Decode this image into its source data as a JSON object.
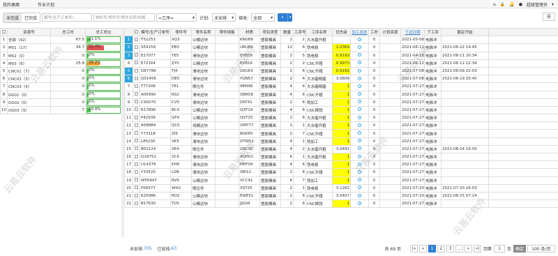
{
  "topbar": {
    "home": "我的桌面",
    "plan": "作业计划",
    "user": "超级管理员"
  },
  "toolbar": {
    "unfinished": "未完成",
    "finished": "已完成",
    "search_order_placeholder": "模号/生产订单号/...",
    "search_part_placeholder": "物料号/零件号/零件名称/规格",
    "process_select": "=工序=",
    "plan_label": "计划:",
    "plan_value": "未安排",
    "accept_label": "接收:",
    "accept_value": "全部"
  },
  "left_table": {
    "headers": [
      "资源号",
      "总工时",
      "总工时比"
    ],
    "rows": [
      {
        "idx": "1",
        "name": "全部（42）",
        "hours": "67.5",
        "pct": "11.1%",
        "ratio": 0.111,
        "color": "#4cc04c"
      },
      {
        "idx": "2",
        "name": "M01（17）",
        "hours": "34.7",
        "pct": "51.4%",
        "ratio": 0.514,
        "color": "#e05050"
      },
      {
        "idx": "3",
        "name": "M02（0）",
        "hours": "0",
        "pct": "0%",
        "ratio": 0,
        "color": "#4cc04c"
      },
      {
        "idx": "4",
        "name": "M03（6）",
        "hours": "25.8",
        "pct": "38.2%",
        "ratio": 0.382,
        "color": "#f0a030"
      },
      {
        "idx": "5",
        "name": "CNC01（7）",
        "hours": "0",
        "pct": "0%",
        "ratio": 0,
        "color": "#4cc04c"
      },
      {
        "idx": "6",
        "name": "CNC02（3）",
        "hours": "0",
        "pct": "0%",
        "ratio": 0,
        "color": "#4cc04c"
      },
      {
        "idx": "7",
        "name": "CNC03（4）",
        "hours": "0",
        "pct": "0%",
        "ratio": 0,
        "color": "#4cc04c"
      },
      {
        "idx": "8",
        "name": "DG01（0）",
        "hours": "0",
        "pct": "0%",
        "ratio": 0,
        "color": "#4cc04c"
      },
      {
        "idx": "9",
        "name": "DG02（0）",
        "hours": "0",
        "pct": "0%",
        "ratio": 0,
        "color": "#4cc04c"
      },
      {
        "idx": "10",
        "name": "DG03（5）",
        "hours": "7",
        "pct": "10.4%",
        "ratio": 0.104,
        "color": "#4cc04c"
      }
    ]
  },
  "main_table": {
    "headers": [
      "模号/生产订单号",
      "零件号",
      "零件名称",
      "零件规格",
      "材质",
      "项目类型",
      "数量",
      "工序号",
      "工序名称",
      "优先级",
      "加工状态",
      "工时",
      "计划资源",
      "下达日期",
      "下工序",
      "额定开始"
    ],
    "rows": [
      {
        "i": "1",
        "hl": true,
        "order": "T52253",
        "part": "XQ3",
        "name": "公模边块",
        "spec": "",
        "mat": "KNU89",
        "type": "塑胶模具",
        "qty": "2",
        "proc": "1",
        "pname": "大水磨开粗",
        "pri": "",
        "y": false,
        "hrs": "0",
        "res": "",
        "date": "2021-05-08",
        "next": "电脉冲",
        "start": ""
      },
      {
        "i": "2",
        "hl": true,
        "order": "S54159",
        "part": "EB3",
        "name": "公模边块",
        "spec": "",
        "mat": "URU89",
        "type": "塑胶模具",
        "qty": "12",
        "proc": "6",
        "pname": "铣电极",
        "pri": "1.0369",
        "y": true,
        "hrs": "0",
        "res": "",
        "date": "2021-06-12",
        "next": "电脉冲",
        "start": "2021-06-22 14:45"
      },
      {
        "i": "3",
        "hl": true,
        "order": "E17077",
        "part": "YE5",
        "name": "滑块边块",
        "spec": "",
        "mat": "EVB56",
        "type": "塑胶模具",
        "qty": "2",
        "proc": "5",
        "pname": "铣电极",
        "pri": "0.9193",
        "y": true,
        "hrs": "0",
        "res": "",
        "date": "2021-04-28",
        "next": "电脉冲",
        "start": "2021-08-11 20:34"
      },
      {
        "i": "4",
        "hl": false,
        "order": "E72164",
        "part": "ZY0",
        "name": "公模边块",
        "spec": "",
        "mat": "EVB16",
        "type": "塑胶模具",
        "qty": "2",
        "proc": "2",
        "pname": "CNC开粗",
        "pri": "0.9973",
        "y": true,
        "hrs": "0",
        "res": "",
        "date": "2021-06-12",
        "next": "电脉冲",
        "start": "2021-06-12 12:34"
      },
      {
        "i": "5",
        "hl": true,
        "order": "D87786",
        "part": "TJ4",
        "name": "滑块边块",
        "spec": "",
        "mat": "GKU63",
        "type": "塑胶模具",
        "qty": "2",
        "proc": "6",
        "pname": "CNC开粗",
        "pri": "0.9192",
        "y": true,
        "hrs": "0",
        "res": "",
        "date": "2021-07-08",
        "next": "电脉冲",
        "start": "2021-08-09 22:03"
      },
      {
        "i": "6",
        "hl": true,
        "order": "Q01456",
        "part": "DE5",
        "name": "滑块边块",
        "spec": "",
        "mat": "YQN57",
        "type": "塑胶模具",
        "qty": "2",
        "proc": "4",
        "pname": "大水磨精磨",
        "pri": "3.0609",
        "y": false,
        "hrs": "0",
        "res": "",
        "date": "2021-07-08",
        "next": "电脉冲",
        "start": "2021-08-19 20:40"
      },
      {
        "i": "7",
        "hl": false,
        "order": "T77208",
        "part": "YE1",
        "name": "限位件",
        "spec": "",
        "mat": "IMM48",
        "type": "塑胶模具",
        "qty": "4",
        "proc": "4",
        "pname": "大水磨精磨",
        "pri": "1",
        "y": true,
        "hrs": "0",
        "res": "",
        "date": "2021-07-27",
        "next": "电脉冲",
        "start": ""
      },
      {
        "i": "8",
        "hl": false,
        "order": "A05990",
        "part": "RS2",
        "name": "滑块边块",
        "spec": "",
        "mat": "QBR58",
        "type": "塑胶模具",
        "qty": "4",
        "proc": "6",
        "pname": "CNC开粗",
        "pri": "1",
        "y": true,
        "hrs": "0",
        "res": "",
        "date": "2021-07-27",
        "next": "电脉冲",
        "start": ""
      },
      {
        "i": "9",
        "hl": false,
        "order": "C95070",
        "part": "CV5",
        "name": "滑块边块",
        "spec": "",
        "mat": "DKT41",
        "type": "塑胶模具",
        "qty": "2",
        "proc": "6",
        "pname": "铣加工",
        "pri": "1",
        "y": true,
        "hrs": "0",
        "res": "",
        "date": "2021-07-27",
        "next": "电脉冲",
        "start": ""
      },
      {
        "i": "10",
        "hl": false,
        "order": "R17896",
        "part": "BC0",
        "name": "公模边块",
        "spec": "",
        "mat": "QZF19",
        "type": "塑胶模具",
        "qty": "4",
        "proc": "6",
        "pname": "CNC精铣",
        "pri": "1",
        "y": true,
        "hrs": "0",
        "res": "",
        "date": "2021-07-27",
        "next": "电脉冲",
        "start": ""
      },
      {
        "i": "11",
        "hl": false,
        "order": "P42939",
        "part": "GF9",
        "name": "公模边块",
        "spec": "",
        "mat": "QVT25",
        "type": "塑胶模具",
        "qty": "2",
        "proc": "6",
        "pname": "大水磨开粗",
        "pri": "1",
        "y": true,
        "hrs": "0",
        "res": "",
        "date": "2021-07-27",
        "next": "电脉冲",
        "start": ""
      },
      {
        "i": "12",
        "hl": false,
        "order": "A58884",
        "part": "QC0",
        "name": "母模边块",
        "spec": "",
        "mat": "OMT77",
        "type": "塑胶模具",
        "qty": "2",
        "proc": "1",
        "pname": "大水磨开粗",
        "pri": "1",
        "y": true,
        "hrs": "0",
        "res": "",
        "date": "2021-07-27",
        "next": "电脉冲",
        "start": ""
      },
      {
        "i": "13",
        "hl": false,
        "order": "Y73118",
        "part": "ZI6",
        "name": "滑块边块",
        "spec": "",
        "mat": "BGK65",
        "type": "塑胶模具",
        "qty": "2",
        "proc": "7",
        "pname": "CNC开粗",
        "pri": "1",
        "y": true,
        "hrs": "0",
        "res": "",
        "date": "2021-07-27",
        "next": "电脉冲",
        "start": ""
      },
      {
        "i": "14",
        "hl": false,
        "order": "L85230",
        "part": "VK5",
        "name": "滑块边块",
        "spec": "",
        "mat": "DTW52",
        "type": "塑胶模具",
        "qty": "4",
        "proc": "1",
        "pname": "铣加工",
        "pri": "1",
        "y": true,
        "hrs": "0",
        "res": "",
        "date": "2021-07-27",
        "next": "电脉冲",
        "start": ""
      },
      {
        "i": "15",
        "hl": false,
        "order": "B02124",
        "part": "XE4",
        "name": "限位件",
        "spec": "",
        "mat": "GRC30",
        "type": "塑胶模具",
        "qty": "4",
        "proc": "2",
        "pname": "大水磨开粗",
        "pri": "3.0491",
        "y": false,
        "hrs": "0",
        "res": "",
        "date": "2021-07-27",
        "next": "电脉冲",
        "start": "2021-08-24 19:05"
      },
      {
        "i": "16",
        "hl": false,
        "order": "Q18752",
        "part": "VC6",
        "name": "滑块边块",
        "spec": "",
        "mat": "AQH01",
        "type": "塑胶模具",
        "qty": "6",
        "proc": "1",
        "pname": "大水磨开粗",
        "pri": "1",
        "y": true,
        "hrs": "0",
        "res": "",
        "date": "2021-07-27",
        "next": "电脉冲",
        "start": ""
      },
      {
        "i": "17",
        "hl": false,
        "order": "U14376",
        "part": "KH6",
        "name": "滑块边块",
        "spec": "",
        "mat": "MEF09",
        "type": "塑胶模具",
        "qty": "4",
        "proc": "6",
        "pname": "铣电极",
        "pri": "1",
        "y": true,
        "hrs": "0",
        "res": "",
        "date": "2021-07-27",
        "next": "电脉冲",
        "start": ""
      },
      {
        "i": "18",
        "hl": false,
        "order": "Y33520",
        "part": "LD8",
        "name": "滑块边块",
        "spec": "",
        "mat": "XBI12",
        "type": "塑胶模具",
        "qty": "2",
        "proc": "6",
        "pname": "CNC开粗",
        "pri": "1",
        "y": true,
        "hrs": "0",
        "res": "",
        "date": "2021-07-27",
        "next": "电脉冲",
        "start": ""
      },
      {
        "i": "19",
        "hl": false,
        "order": "W55947",
        "part": "RV9",
        "name": "公模边块",
        "spec": "",
        "mat": "VCC91",
        "type": "塑胶模具",
        "qty": "6",
        "proc": "7",
        "pname": "铣加工",
        "pri": "1",
        "y": true,
        "hrs": "0",
        "res": "",
        "date": "2021-07-27",
        "next": "电脉冲",
        "start": ""
      },
      {
        "i": "20",
        "hl": false,
        "order": "P06577",
        "part": "WH2",
        "name": "限位件",
        "spec": "",
        "mat": "XST25",
        "type": "塑胶模具",
        "qty": "2",
        "proc": "1",
        "pname": "铣电极",
        "pri": "3.1262",
        "y": false,
        "hrs": "0",
        "res": "",
        "date": "2021-07-20",
        "next": "电脉冲",
        "start": "2021-07-20 16:03"
      },
      {
        "i": "21",
        "hl": false,
        "order": "K25086",
        "part": "RD2",
        "name": "公模边块",
        "spec": "",
        "mat": "EWE51",
        "type": "塑胶模具",
        "qty": "2",
        "proc": "6",
        "pname": "CNC开粗",
        "pri": "3.0407",
        "y": false,
        "hrs": "0",
        "res": "",
        "date": "2021-07-20",
        "next": "电脉冲",
        "start": "2021-08-25 07:14"
      },
      {
        "i": "22",
        "hl": false,
        "order": "B17630",
        "part": "TU5",
        "name": "公模边块",
        "spec": "",
        "mat": "JJG04",
        "type": "塑胶模具",
        "qty": "2",
        "proc": "6",
        "pname": "CNC精铣",
        "pri": "1",
        "y": true,
        "hrs": "0",
        "res": "",
        "date": "2021-07-27",
        "next": "电脉冲",
        "start": ""
      }
    ]
  },
  "footer": {
    "unscheduled_label": "未安排:",
    "unscheduled": "705",
    "scheduled_label": "已安排:",
    "scheduled": "63",
    "total": "共 69 页",
    "pages": [
      "1",
      "2",
      "3",
      "...",
      "»",
      "»|"
    ],
    "jump_label": "到第",
    "jump_value": "1",
    "page_unit": "页",
    "go": "确定",
    "per_page": "100 条/页"
  },
  "watermark": "云易云软件",
  "colors": {
    "accent": "#2f7fd1",
    "highlight": "#2aa7e0",
    "priority": "#ffff00"
  }
}
